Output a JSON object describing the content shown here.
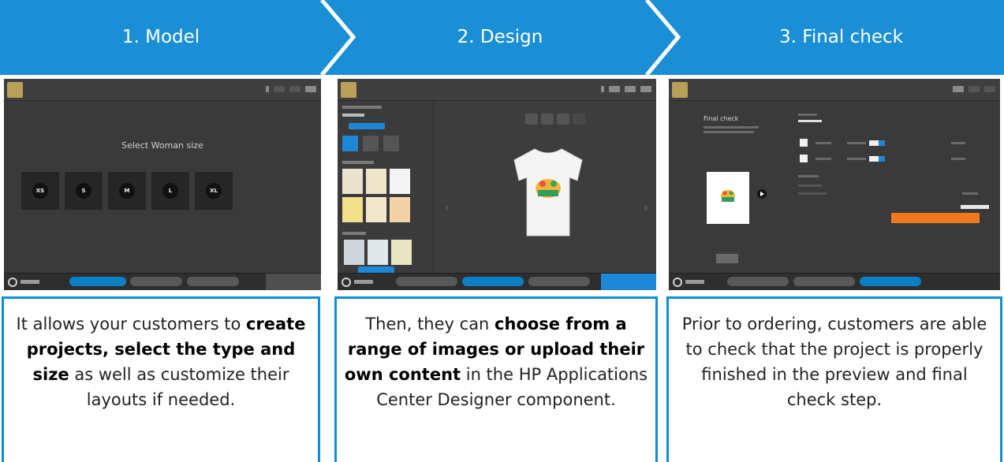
{
  "steps": [
    {
      "label": "1. Model"
    },
    {
      "label": "2. Design"
    },
    {
      "label": "3. Final check"
    }
  ],
  "colors": {
    "banner": "#1a8fd5",
    "box_border": "#0f8fd8",
    "app_dark": "#3a3a3a",
    "accent_blue": "#1e88d6",
    "order_orange": "#f07820"
  },
  "panel1": {
    "title": "Select Woman size",
    "sizes": [
      "XS",
      "S",
      "M",
      "L",
      "XL"
    ]
  },
  "panel3": {
    "title": "Final check"
  },
  "descriptions": [
    {
      "parts": [
        {
          "text": "It allows your customers to ",
          "highlight": false
        },
        {
          "text": "create projects, select the type and size",
          "highlight": true
        },
        {
          "text": " as well as customize their layouts if needed.",
          "highlight": false
        }
      ]
    },
    {
      "parts": [
        {
          "text": "Then, they can ",
          "highlight": false
        },
        {
          "text": "choose from a range of images or upload their own content",
          "highlight": true
        },
        {
          "text": " in the HP Applications Center Designer component.",
          "highlight": false
        }
      ]
    },
    {
      "parts": [
        {
          "text": "Prior to ordering, customers are able to check that the project is properly finished in the preview and final check step.",
          "highlight": false
        }
      ]
    }
  ]
}
